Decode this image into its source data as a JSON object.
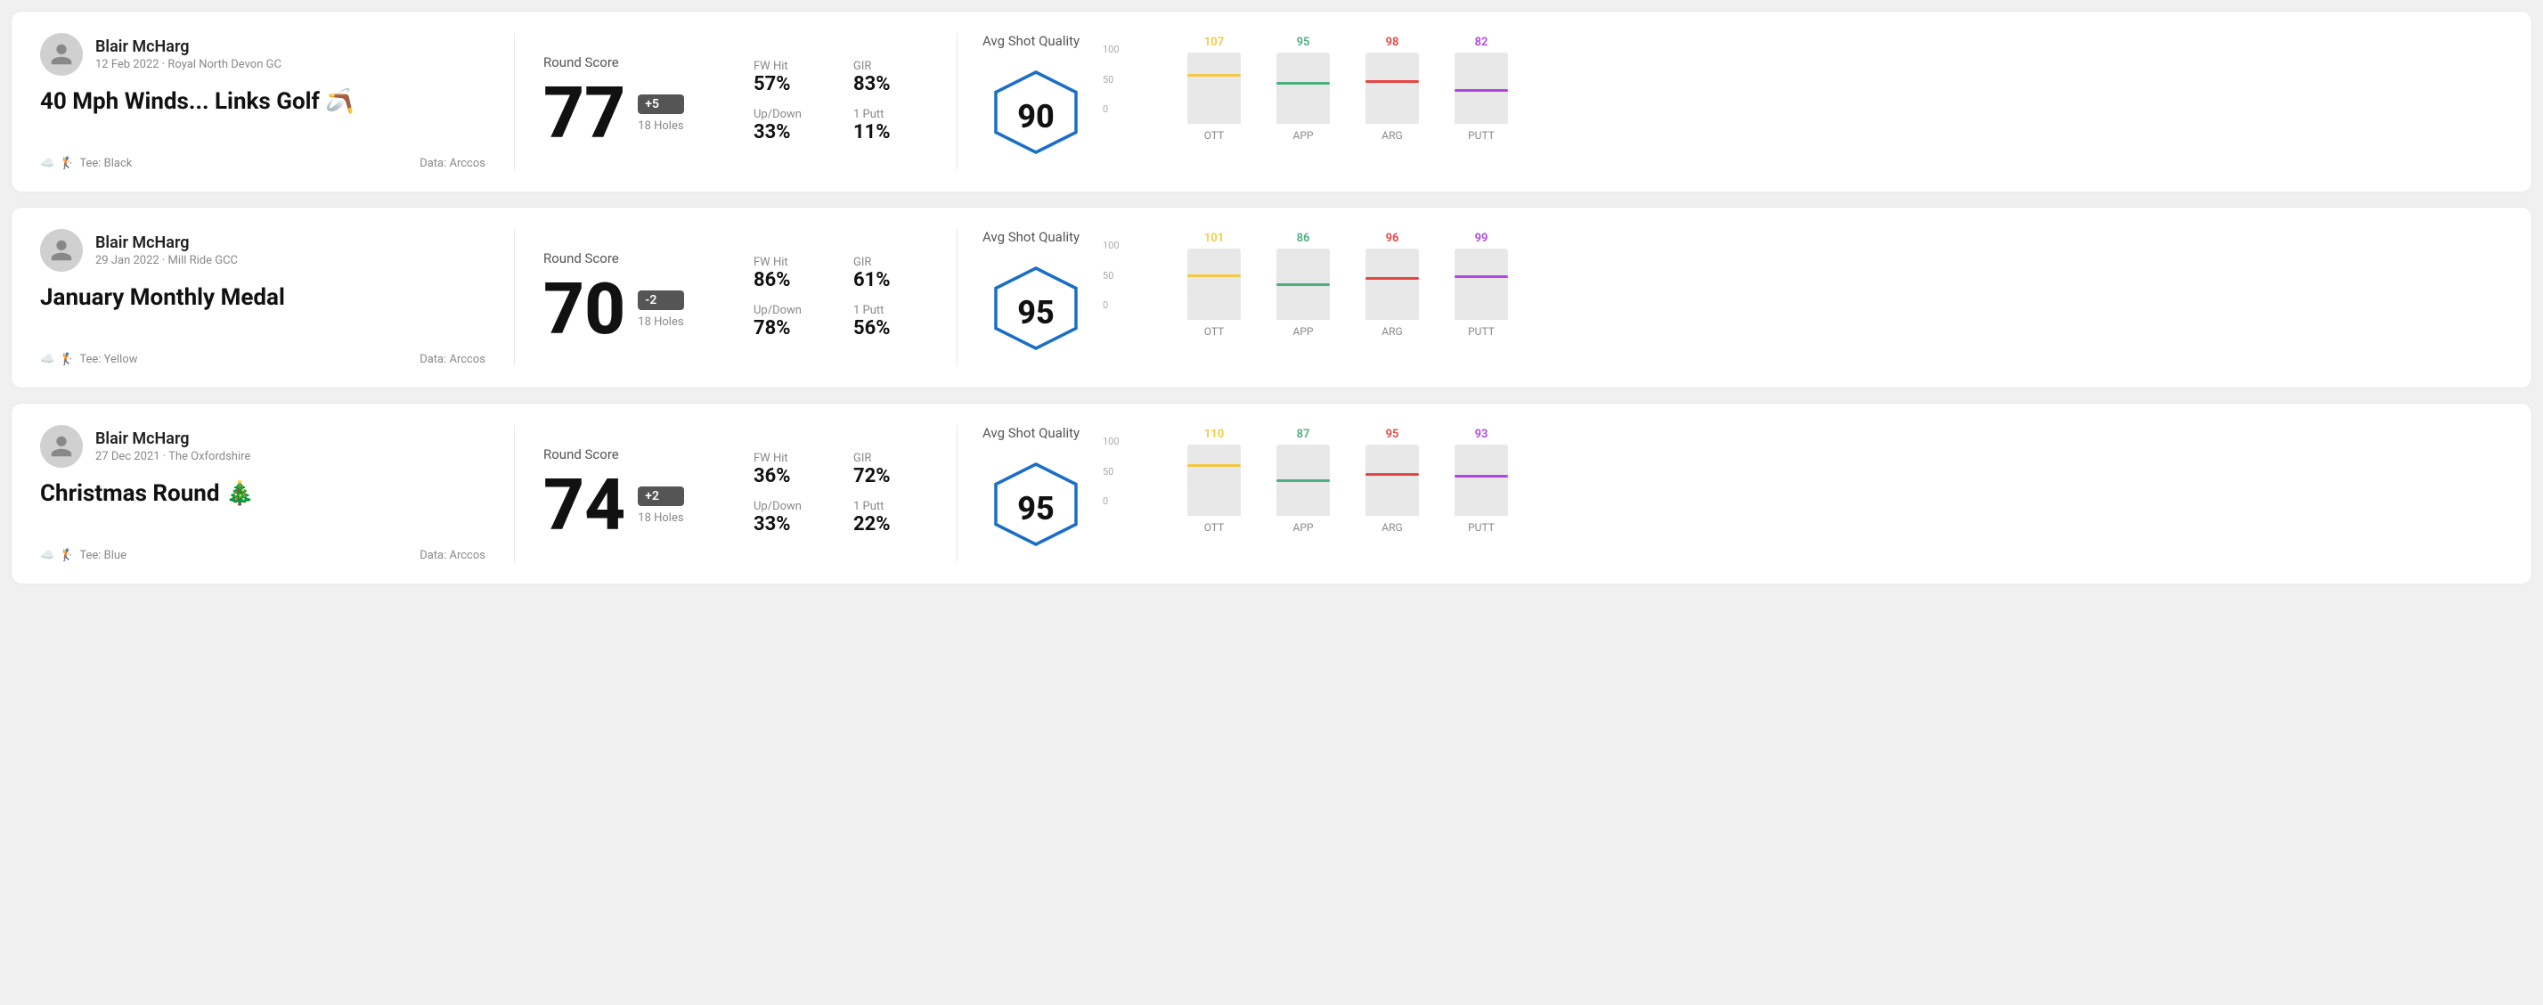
{
  "rounds": [
    {
      "id": "round1",
      "user": {
        "name": "Blair McHarg",
        "date": "12 Feb 2022 · Royal North Devon GC"
      },
      "title": "40 Mph Winds... Links Golf 🪃",
      "tee": "Black",
      "data_source": "Data: Arccos",
      "score": {
        "number": "77",
        "badge": "+5",
        "holes": "18 Holes"
      },
      "stats": {
        "fw_hit_label": "FW Hit",
        "fw_hit_value": "57%",
        "gir_label": "GIR",
        "gir_value": "83%",
        "updown_label": "Up/Down",
        "updown_value": "33%",
        "oneputt_label": "1 Putt",
        "oneputt_value": "11%"
      },
      "quality": {
        "label": "Avg Shot Quality",
        "score": "90"
      },
      "chart": {
        "bars": [
          {
            "label": "OTT",
            "value": 107,
            "color": "#f5c842",
            "height_pct": 72
          },
          {
            "label": "APP",
            "value": 95,
            "color": "#4caf7d",
            "height_pct": 60
          },
          {
            "label": "ARG",
            "value": 98,
            "color": "#e84444",
            "height_pct": 63
          },
          {
            "label": "PUTT",
            "value": 82,
            "color": "#b044e8",
            "height_pct": 50
          }
        ]
      }
    },
    {
      "id": "round2",
      "user": {
        "name": "Blair McHarg",
        "date": "29 Jan 2022 · Mill Ride GCC"
      },
      "title": "January Monthly Medal",
      "tee": "Yellow",
      "data_source": "Data: Arccos",
      "score": {
        "number": "70",
        "badge": "-2",
        "holes": "18 Holes"
      },
      "stats": {
        "fw_hit_label": "FW Hit",
        "fw_hit_value": "86%",
        "gir_label": "GIR",
        "gir_value": "61%",
        "updown_label": "Up/Down",
        "updown_value": "78%",
        "oneputt_label": "1 Putt",
        "oneputt_value": "56%"
      },
      "quality": {
        "label": "Avg Shot Quality",
        "score": "95"
      },
      "chart": {
        "bars": [
          {
            "label": "OTT",
            "value": 101,
            "color": "#f5c842",
            "height_pct": 66
          },
          {
            "label": "APP",
            "value": 86,
            "color": "#4caf7d",
            "height_pct": 52
          },
          {
            "label": "ARG",
            "value": 96,
            "color": "#e84444",
            "height_pct": 62
          },
          {
            "label": "PUTT",
            "value": 99,
            "color": "#b044e8",
            "height_pct": 64
          }
        ]
      }
    },
    {
      "id": "round3",
      "user": {
        "name": "Blair McHarg",
        "date": "27 Dec 2021 · The Oxfordshire"
      },
      "title": "Christmas Round 🎄",
      "tee": "Blue",
      "data_source": "Data: Arccos",
      "score": {
        "number": "74",
        "badge": "+2",
        "holes": "18 Holes"
      },
      "stats": {
        "fw_hit_label": "FW Hit",
        "fw_hit_value": "36%",
        "gir_label": "GIR",
        "gir_value": "72%",
        "updown_label": "Up/Down",
        "updown_value": "33%",
        "oneputt_label": "1 Putt",
        "oneputt_value": "22%"
      },
      "quality": {
        "label": "Avg Shot Quality",
        "score": "95"
      },
      "chart": {
        "bars": [
          {
            "label": "OTT",
            "value": 110,
            "color": "#f5c842",
            "height_pct": 74
          },
          {
            "label": "APP",
            "value": 87,
            "color": "#4caf7d",
            "height_pct": 53
          },
          {
            "label": "ARG",
            "value": 95,
            "color": "#e84444",
            "height_pct": 61
          },
          {
            "label": "PUTT",
            "value": 93,
            "color": "#b044e8",
            "height_pct": 59
          }
        ]
      }
    }
  ],
  "y_axis": {
    "top": "100",
    "mid": "50",
    "bot": "0"
  }
}
